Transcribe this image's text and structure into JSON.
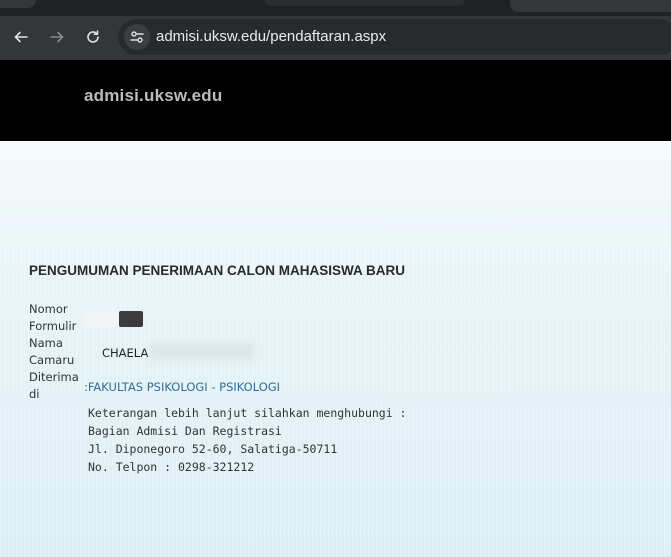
{
  "browser": {
    "url": "admisi.uksw.edu/pendaftaran.aspx",
    "icons": [
      "back-arrow-icon",
      "forward-arrow-icon",
      "reload-icon",
      "site-settings-icon"
    ]
  },
  "site": {
    "title": "admisi.uksw.edu"
  },
  "announcement": {
    "title": "PENGUMUMAN PENERIMAAN CALON MAHASISWA BARU",
    "labels": {
      "nomor_formulir_1": "Nomor",
      "nomor_formulir_2": "Formulir",
      "nama_camaru_1": "Nama",
      "nama_camaru_2": "Camaru",
      "diterima_di_1": "Diterima",
      "diterima_di_2": "di"
    },
    "nama_value": "CHAELA",
    "faculty": ":FAKULTAS PSIKOLOGI - PSIKOLOGI",
    "contact": [
      "Keterangan lebih lanjut silahkan menghubungi :",
      "Bagian Admisi Dan Registrasi",
      "Jl. Diponegoro 52-60, Salatiga-50711",
      "No. Telpon : 0298-321212"
    ]
  },
  "colors": {
    "chrome_bg": "#35363a",
    "header_bg": "#000000",
    "faculty_link": "#2e6f97"
  }
}
